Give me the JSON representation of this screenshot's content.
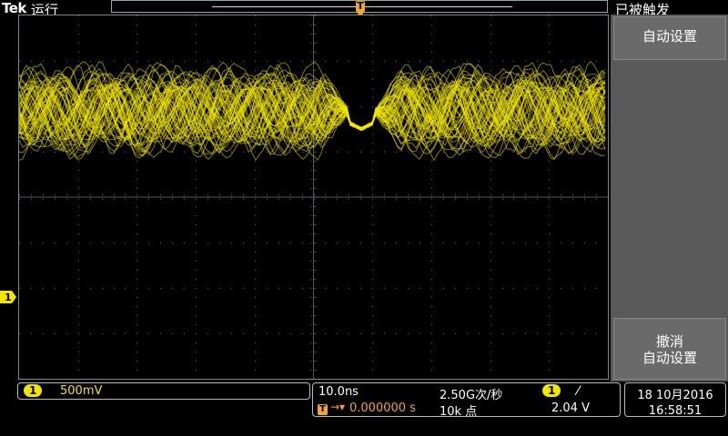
{
  "header": {
    "brand": "Tek",
    "run_state": "运行",
    "trigger_state": "已被触发",
    "trigger_marker": "T"
  },
  "side_menu": {
    "autoset_label": "自动设置",
    "undo_line1": "撤消",
    "undo_line2": "自动设置"
  },
  "status": {
    "channel_number": "1",
    "volts_per_div": "500mV",
    "time_per_div": "10.0ns",
    "trigger_icon": "T",
    "trigger_position": "0.000000 s",
    "sample_rate": "2.50G次/秒",
    "record_length": "10k 点",
    "trigger_channel": "1",
    "trigger_slope_symbol": "⁄",
    "trigger_level": "2.04 V",
    "date": "18 10月2016",
    "time": "16:58:51"
  },
  "channel_marker": {
    "label": "1"
  },
  "colors": {
    "channel1": "#f2e600",
    "trigger": "#f5a623",
    "side_panel": "#595959"
  }
}
